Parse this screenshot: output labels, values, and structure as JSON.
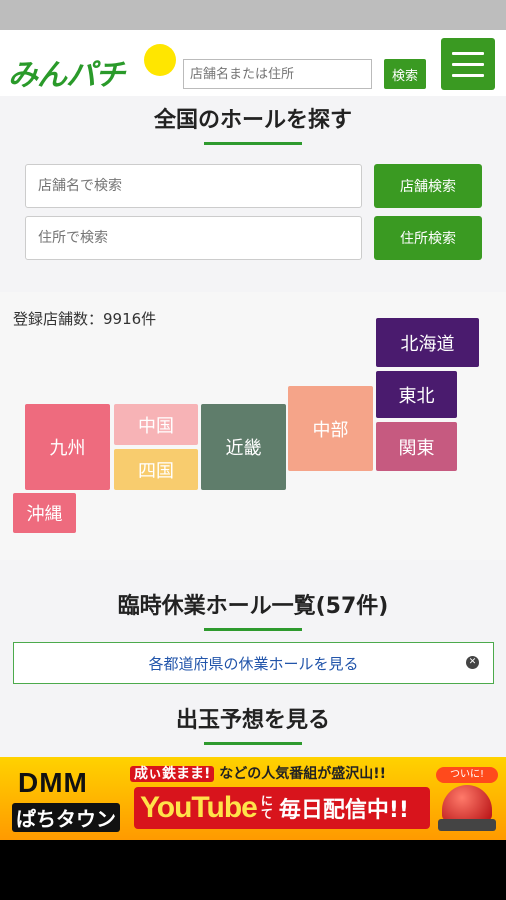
{
  "header": {
    "logo_text": "みんパチ",
    "search_placeholder": "店舗名または住所",
    "search_button": "検索",
    "menu_icon": "hamburger-menu-icon"
  },
  "find_hall": {
    "title": "全国のホールを探す",
    "store_name_placeholder": "店舗名で検索",
    "store_name_button": "店舗検索",
    "address_placeholder": "住所で検索",
    "address_button": "住所検索"
  },
  "map": {
    "store_count": "登録店舗数：9916件",
    "regions": [
      {
        "label": "北海道",
        "color": "#4a1b6e"
      },
      {
        "label": "東北",
        "color": "#4a1b6e"
      },
      {
        "label": "関東",
        "color": "#c65a80"
      },
      {
        "label": "中部",
        "color": "#f5a489"
      },
      {
        "label": "近畿",
        "color": "#5f7d6b"
      },
      {
        "label": "中国",
        "color": "#f7b3b6"
      },
      {
        "label": "四国",
        "color": "#f8cc6e"
      },
      {
        "label": "九州",
        "color": "#ee6b7e"
      },
      {
        "label": "沖縄",
        "color": "#ee6b7e"
      }
    ]
  },
  "closures": {
    "title": "臨時休業ホール一覧(57件)",
    "link": "各都道府県の休業ホールを見る",
    "close_icon": "close-icon"
  },
  "prediction": {
    "title": "出玉予想を見る"
  },
  "banner": {
    "dmm": "DMM",
    "pachi": "ぱちタウン",
    "top_highlight": "成ぃ鉄まま!",
    "top_text": "などの人気番組が盛沢山!!",
    "youtube": "YouTube",
    "nite": "にて",
    "daily": "毎日配信中!!",
    "sticker": "ついに!"
  }
}
